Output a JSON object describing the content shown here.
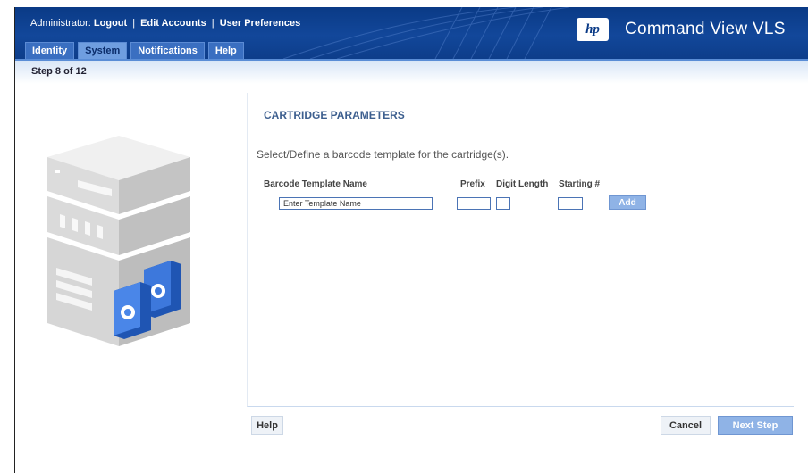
{
  "header": {
    "admin_prefix": "Administrator:",
    "links": [
      "Logout",
      "Edit Accounts",
      "User Preferences"
    ],
    "separator": "|",
    "logo_text": "hp",
    "product_title": "Command View VLS",
    "bar_color": "#0d3d8a"
  },
  "tabs": [
    {
      "label": "Identity",
      "active": false
    },
    {
      "label": "System",
      "active": true
    },
    {
      "label": "Notifications",
      "active": false
    },
    {
      "label": "Help",
      "active": false
    }
  ],
  "step": {
    "label": "Step 8 of 12"
  },
  "illustration": {
    "icon": "library-cartridge-illustration-icon"
  },
  "form": {
    "section_title": "CARTRIDGE PARAMETERS",
    "instructions": "Select/Define a barcode template for the cartridge(s).",
    "columns": {
      "template_name": "Barcode Template Name",
      "prefix": "Prefix",
      "digit_length": "Digit Length",
      "starting": "Starting #"
    },
    "fields": {
      "template_name_value": "Enter Template Name",
      "prefix_value": "",
      "digit_length_value": "",
      "starting_value": ""
    },
    "add_label": "Add"
  },
  "footer": {
    "help_label": "Help",
    "cancel_label": "Cancel",
    "next_label": "Next Step",
    "accent_color": "#8fb3e6"
  }
}
